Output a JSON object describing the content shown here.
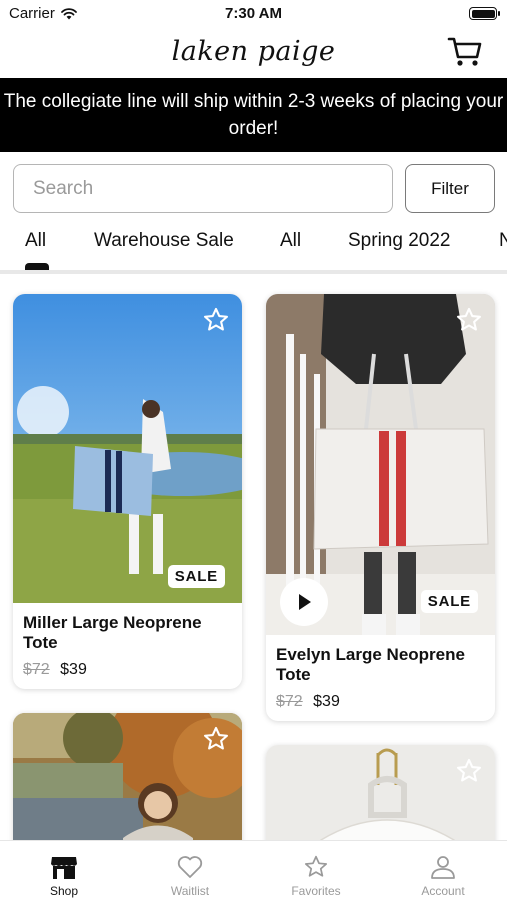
{
  "status_bar": {
    "carrier": "Carrier",
    "time": "7:30 AM",
    "wifi_icon": "wifi-icon",
    "battery_icon": "battery-icon"
  },
  "header": {
    "logo_text": "laken paige",
    "cart_icon": "cart-icon"
  },
  "banner": {
    "text": "The collegiate line will ship within 2-3 weeks of placing your order!"
  },
  "search": {
    "placeholder": "Search",
    "value": "",
    "filter_label": "Filter"
  },
  "category_tabs": [
    {
      "label": "All",
      "active": true
    },
    {
      "label": "Warehouse Sale",
      "active": false
    },
    {
      "label": "All",
      "active": false
    },
    {
      "label": "Spring 2022",
      "active": false
    },
    {
      "label": "N",
      "active": false
    }
  ],
  "products": [
    {
      "title": "Miller Large Neoprene Tote",
      "old_price": "$72",
      "price": "$39",
      "badge": "SALE",
      "has_video": false,
      "favorited": false
    },
    {
      "title": "Evelyn Large Neoprene Tote",
      "old_price": "$72",
      "price": "$39",
      "badge": "SALE",
      "has_video": true,
      "favorited": false
    },
    {
      "title": "",
      "old_price": "",
      "price": "",
      "badge": "",
      "has_video": false,
      "favorited": false
    },
    {
      "title": "",
      "old_price": "",
      "price": "",
      "badge": "",
      "has_video": false,
      "favorited": false
    }
  ],
  "bottom_nav": [
    {
      "label": "Shop",
      "icon": "storefront-icon",
      "active": true
    },
    {
      "label": "Waitlist",
      "icon": "heart-icon",
      "active": false
    },
    {
      "label": "Favorites",
      "icon": "star-icon",
      "active": false
    },
    {
      "label": "Account",
      "icon": "person-icon",
      "active": false
    }
  ],
  "colors": {
    "banner_bg": "#000000",
    "text": "#111111",
    "muted": "#9a9a9a",
    "strike": "#9a9a9a",
    "border": "#b5b5b5"
  }
}
